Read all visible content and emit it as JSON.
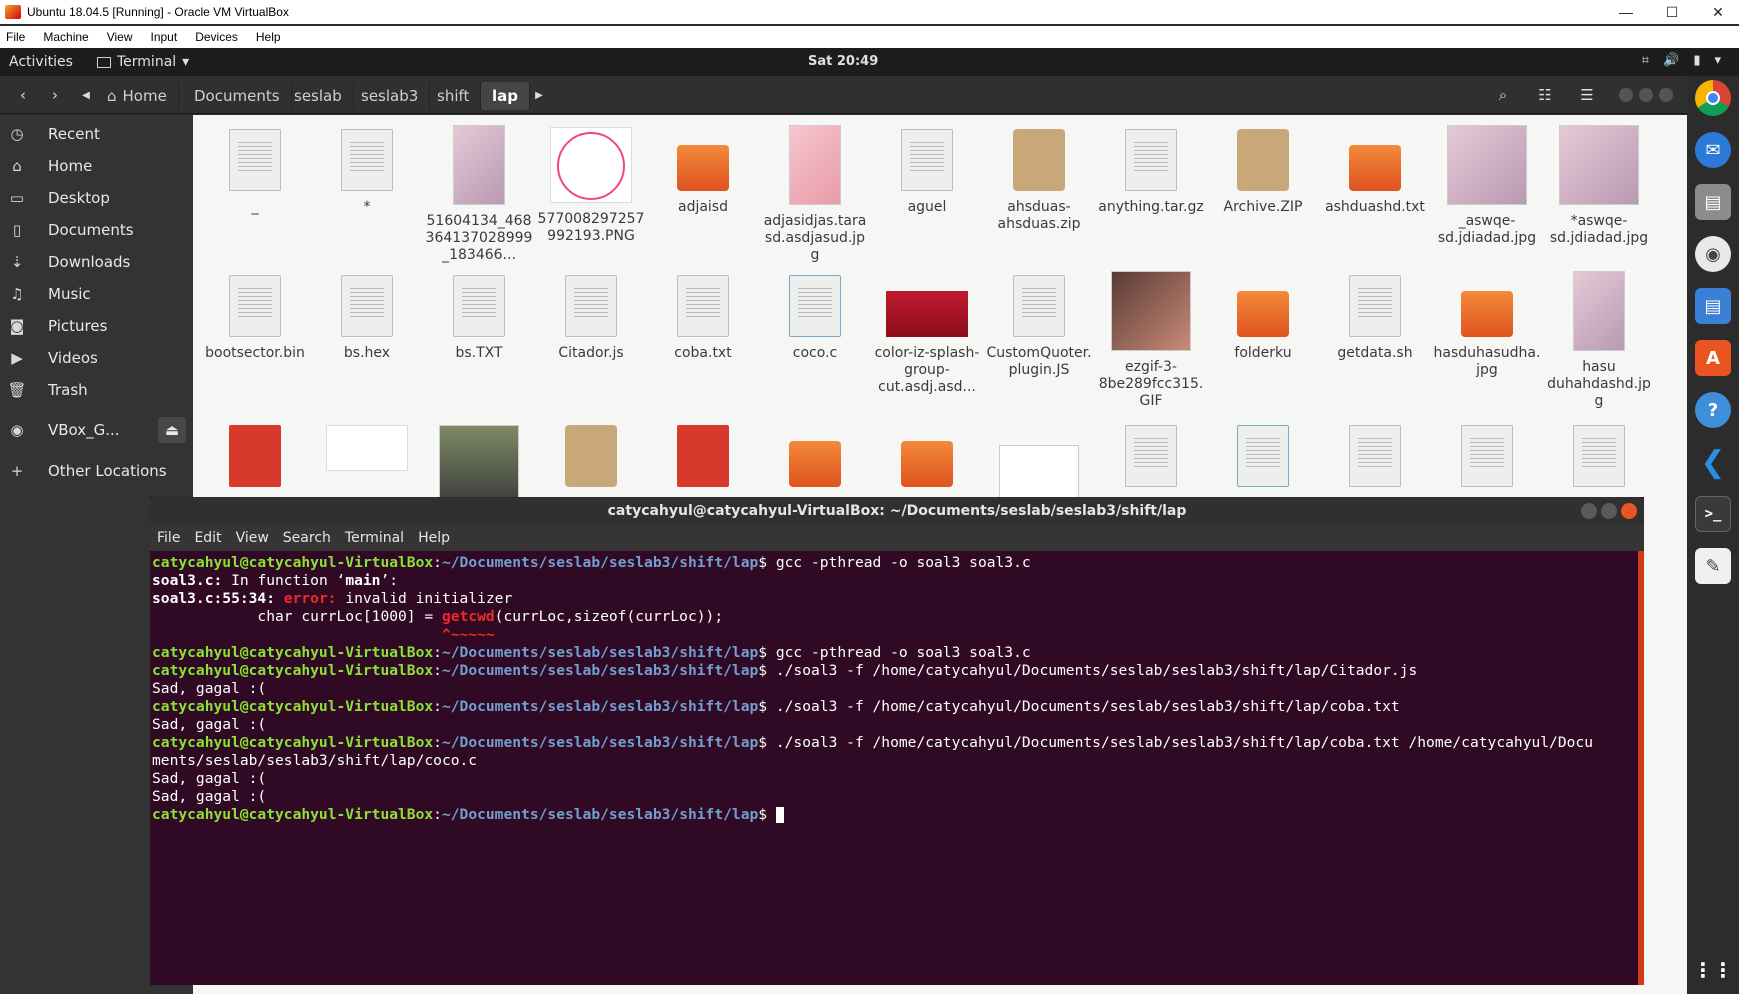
{
  "vbox": {
    "title": "Ubuntu 18.04.5 [Running] - Oracle VM VirtualBox",
    "menu": [
      "File",
      "Machine",
      "View",
      "Input",
      "Devices",
      "Help"
    ],
    "minimize": "—",
    "maximize": "☐",
    "close": "✕"
  },
  "topbar": {
    "activities": "Activities",
    "app": "Terminal",
    "clock": "Sat 20:49"
  },
  "header": {
    "back": "‹",
    "forward": "›",
    "crumbs": [
      "Home",
      "Documents",
      "seslab",
      "seslab3",
      "shift",
      "lap"
    ]
  },
  "sidebar": {
    "items": [
      {
        "label": "Recent",
        "icon": "clock-icon"
      },
      {
        "label": "Home",
        "icon": "home-icon"
      },
      {
        "label": "Desktop",
        "icon": "desktop-icon"
      },
      {
        "label": "Documents",
        "icon": "document-icon"
      },
      {
        "label": "Downloads",
        "icon": "download-icon"
      },
      {
        "label": "Music",
        "icon": "music-icon"
      },
      {
        "label": "Pictures",
        "icon": "camera-icon"
      },
      {
        "label": "Videos",
        "icon": "video-icon"
      },
      {
        "label": "Trash",
        "icon": "trash-icon"
      },
      {
        "label": "VBox_G...",
        "icon": "disc-icon"
      },
      {
        "label": "Other Locations",
        "icon": "plus-icon"
      }
    ]
  },
  "files": {
    "row1": [
      {
        "name": "_",
        "kind": "doc"
      },
      {
        "name": "*",
        "kind": "doc"
      },
      {
        "name": "51604134_468364137028999_183466...",
        "kind": "img"
      },
      {
        "name": "577008297257992193.PNG",
        "kind": "img"
      },
      {
        "name": "adjaisd",
        "kind": "folder"
      },
      {
        "name": "adjasidjas.tarasd.asdjasud.jpg",
        "kind": "img"
      },
      {
        "name": "aguel",
        "kind": "doc"
      },
      {
        "name": "ahsduas-ahsduas.zip",
        "kind": "zip"
      },
      {
        "name": "anything.tar.gz",
        "kind": "doc"
      },
      {
        "name": "Archive.ZIP",
        "kind": "zip"
      },
      {
        "name": "ashduashd.txt",
        "kind": "folder"
      },
      {
        "name": "_aswqe-sd.jdiadad.jpg",
        "kind": "img"
      },
      {
        "name": "*aswqe-sd.jdiadad.jpg",
        "kind": "img"
      }
    ],
    "row2": [
      {
        "name": "bootsector.bin",
        "kind": "doc"
      },
      {
        "name": "bs.hex",
        "kind": "doc"
      },
      {
        "name": "bs.TXT",
        "kind": "doc"
      },
      {
        "name": "Citador.js",
        "kind": "doc"
      },
      {
        "name": "coba.txt",
        "kind": "doc"
      },
      {
        "name": "coco.c",
        "kind": "doc"
      },
      {
        "name": "color-iz-splash-group-cut.asdj.asd...",
        "kind": "img"
      },
      {
        "name": "CustomQuoter.plugin.JS",
        "kind": "doc"
      },
      {
        "name": "ezgif-3-8be289fcc315.GIF",
        "kind": "img"
      },
      {
        "name": "folderku",
        "kind": "folder"
      },
      {
        "name": "getdata.sh",
        "kind": "doc"
      },
      {
        "name": "hasduhasudha.jpg",
        "kind": "folder"
      },
      {
        "name": "hasu duhahdashd.jpg",
        "kind": "img"
      }
    ]
  },
  "terminal": {
    "title": "catycahyul@catycahyul-VirtualBox: ~/Documents/seslab/seslab3/shift/lap",
    "menu": [
      "File",
      "Edit",
      "View",
      "Search",
      "Terminal",
      "Help"
    ],
    "user": "catycahyul@catycahyul-VirtualBox",
    "path": "~/Documents/seslab/seslab3/shift/lap",
    "cmd1": " gcc -pthread -o soal3 soal3.c",
    "l2a": "soal3.c:",
    "l2b": " In function ‘",
    "l2c": "main",
    "l2d": "’:",
    "l3a": "soal3.c:55:34: ",
    "l3b": "error: ",
    "l3c": "invalid initializer",
    "l4a": "            char currLoc[1000] = ",
    "l4b": "getcwd",
    "l4c": "(currLoc,sizeof(currLoc));",
    "l5": "                                 ^~~~~~",
    "cmd2": " gcc -pthread -o soal3 soal3.c",
    "cmd3": " ./soal3 -f /home/catycahyul/Documents/seslab/seslab3/shift/lap/Citador.js",
    "out1": "Sad, gagal :(",
    "cmd4": " ./soal3 -f /home/catycahyul/Documents/seslab/seslab3/shift/lap/coba.txt",
    "out2": "Sad, gagal :(",
    "cmd5": " ./soal3 -f /home/catycahyul/Documents/seslab/seslab3/shift/lap/coba.txt /home/catycahyul/Docu",
    "cmd5b": "ments/seslab/seslab3/shift/lap/coco.c",
    "out3": "Sad, gagal :(",
    "out4": "Sad, gagal :("
  }
}
